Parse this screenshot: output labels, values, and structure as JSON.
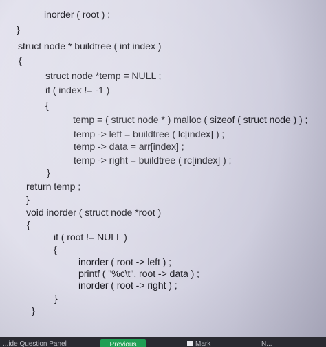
{
  "code_lines": [
    "inorder ( root ) ;",
    "}",
    "struct node * buildtree ( int index )",
    "{",
    "struct node *temp = NULL ;",
    "if ( index != -1 )",
    "{",
    "temp = ( struct node * ) malloc ( sizeof ( struct node ) ) ;",
    "temp -> left = buildtree ( lc[index] ) ;",
    "temp -> data = arr[index] ;",
    "temp -> right = buildtree ( rc[index] ) ;",
    "}",
    "return temp ;",
    "}",
    "void inorder ( struct node *root )",
    "{",
    "if ( root != NULL )",
    "{",
    "inorder ( root -> left ) ;",
    "printf ( \"%c\\t\", root -> data ) ;",
    "inorder ( root -> right ) ;",
    "}",
    "}"
  ],
  "bottom_bar": {
    "question_panel_label": "...ide Question Panel",
    "previous_label": "Previous",
    "mark_label": "Mark",
    "next_label": "N..."
  }
}
